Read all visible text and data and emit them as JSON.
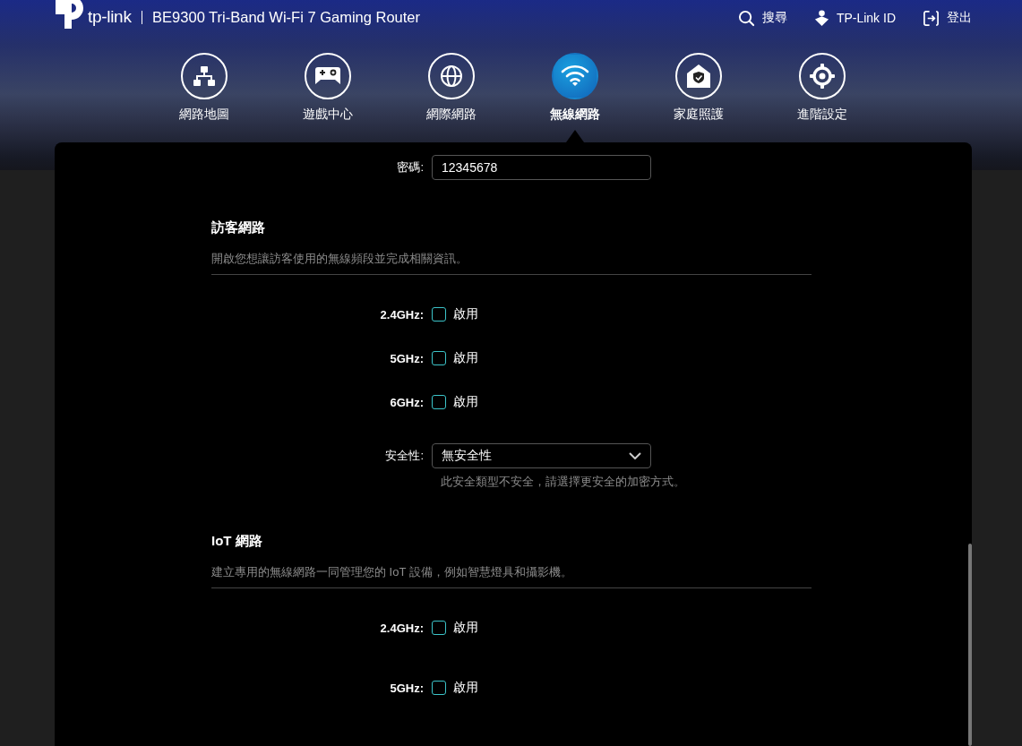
{
  "header": {
    "logo": "tp-link",
    "model": "BE9300 Tri-Band Wi-Fi 7 Gaming Router",
    "actions": [
      {
        "kind": "search",
        "label": "搜尋"
      },
      {
        "kind": "account",
        "label": "TP-Link ID"
      },
      {
        "kind": "logout",
        "label": "登出"
      }
    ]
  },
  "nav": [
    {
      "label": "網路地圖",
      "kind": "topology",
      "selected": false
    },
    {
      "label": "遊戲中心",
      "kind": "gamepad",
      "selected": false
    },
    {
      "label": "網際網路",
      "kind": "globe",
      "selected": false
    },
    {
      "label": "無線網路",
      "kind": "wifi",
      "selected": true
    },
    {
      "label": "家庭照護",
      "kind": "house",
      "selected": false
    },
    {
      "label": "進階設定",
      "kind": "gear",
      "selected": false
    }
  ],
  "password": {
    "label": "密碼:",
    "value": "12345678"
  },
  "sections": [
    {
      "title": "訪客網路",
      "description": "開啟您想讓訪客使用的無線頻段並完成相關資訊。",
      "bands": [
        {
          "label": "2.4GHz:",
          "option": "啟用",
          "checked": false
        },
        {
          "label": "5GHz:",
          "option": "啟用",
          "checked": false
        },
        {
          "label": "6GHz:",
          "option": "啟用",
          "checked": false
        }
      ],
      "security": {
        "label": "安全性:",
        "value": "無安全性",
        "warning": "此安全類型不安全，請選擇更安全的加密方式。"
      }
    },
    {
      "title": "IoT 網路",
      "description": "建立專用的無線網路一同管理您的 IoT 設備，例如智慧燈具和攝影機。",
      "bands": [
        {
          "label": "2.4GHz:",
          "option": "啟用",
          "checked": false
        },
        {
          "label": "5GHz:",
          "option": "啟用",
          "checked": false
        }
      ]
    }
  ]
}
